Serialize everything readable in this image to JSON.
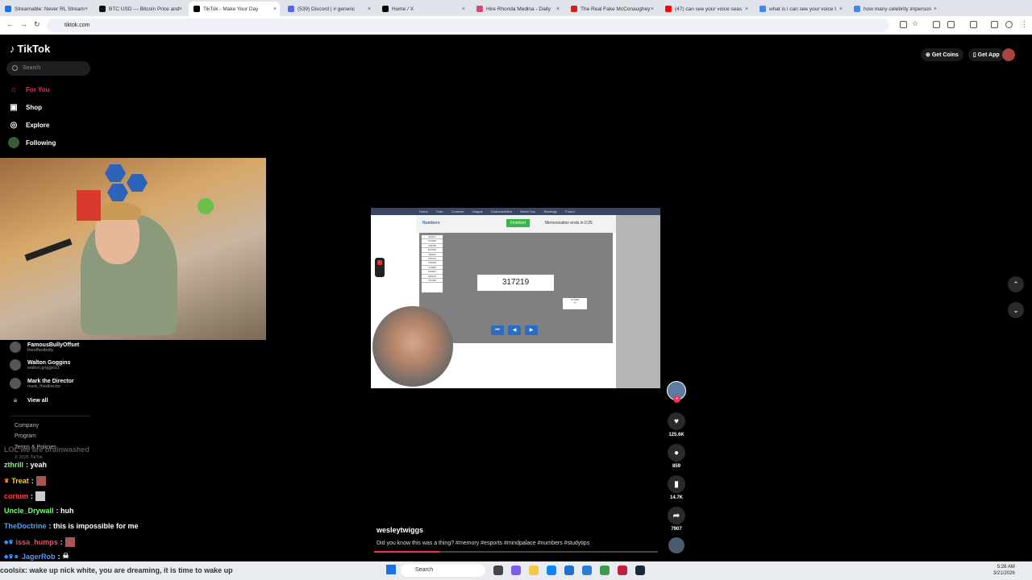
{
  "browser": {
    "tabs": [
      {
        "title": "Streamable: Never RL Stream",
        "color": "#1a73e8"
      },
      {
        "title": "BTC USD — Bitcoin Price and",
        "color": "#111111"
      },
      {
        "title": "TikTok - Make Your Day",
        "color": "#000000"
      },
      {
        "title": "(539) Discord | # generic",
        "color": "#5865f2"
      },
      {
        "title": "Home / X",
        "color": "#000000"
      },
      {
        "title": "Hire Rhonda Medina - Daily",
        "color": "#d14a7a"
      },
      {
        "title": "The Real Fake McConaughey",
        "color": "#cc2222"
      },
      {
        "title": "(47) can see your voice seas",
        "color": "#ff0000"
      },
      {
        "title": "what is i can see your voice t",
        "color": "#4285f4"
      },
      {
        "title": "how many celebrity imperson",
        "color": "#4285f4"
      }
    ],
    "url": "tiktok.com"
  },
  "tiktok": {
    "logo": "TikTok",
    "search_placeholder": "Search",
    "nav": [
      {
        "label": "For You",
        "icon": "home-icon"
      },
      {
        "label": "Shop",
        "icon": "shop-icon"
      },
      {
        "label": "Explore",
        "icon": "compass-icon"
      },
      {
        "label": "Following",
        "icon": "users-icon"
      }
    ],
    "following": [
      {
        "name": "FamousBullyOffset",
        "handle": "theoffsetbully"
      },
      {
        "name": "Walton Goggins",
        "handle": "walton.goggins1"
      },
      {
        "name": "Mark the Director",
        "handle": "mark_thedirector"
      }
    ],
    "view_all": "View all",
    "footer": [
      "Company",
      "Program",
      "Terms & Policies",
      "© 2026 TikTok"
    ],
    "get_coins": "Get Coins",
    "get_app": "Get App",
    "video": {
      "site_nav": [
        "Home",
        "Train",
        "Contests",
        "League",
        "Characteristics",
        "World Tour",
        "Rankings",
        "Forum"
      ],
      "section": "Numbers",
      "button": "Finished",
      "timer": "Memorization ends in 0:25",
      "numbers": [
        "536017",
        "072096",
        "748786",
        "547336",
        "256811",
        "752472",
        "793336",
        "376896",
        "183697",
        "981120",
        "767096"
      ],
      "current_number": "317219",
      "small_box": [
        "071298",
        "??"
      ]
    },
    "actions": {
      "likes": "125.6K",
      "comments": "859",
      "saves": "14.7K",
      "shares": "7907"
    },
    "author": "wesleytwiggs",
    "caption": "Did you know this was a thing? #memory #esports #mindpalace #numbers #studytips",
    "progress": 0.23
  },
  "chat": {
    "ghost": "LOL we are brainwashed",
    "messages": [
      {
        "user": "zthrill",
        "text": ": yeah",
        "color": "#7cfc7c"
      },
      {
        "user": "Treat",
        "text": ":",
        "color": "#ffd700"
      },
      {
        "user": "corium",
        "text": ":",
        "color": "#ff4444"
      },
      {
        "user": "Uncle_Drywall",
        "text": ": huh",
        "color": "#7cfc7c"
      },
      {
        "user": "TheDoctrine",
        "text": ": this is impossible for me",
        "color": "#4aa3ff"
      },
      {
        "user": "issa_humps",
        "text": ":",
        "color": "#ff4466"
      },
      {
        "user": "JagerRob",
        "text": ":",
        "color": "#5599ff"
      }
    ],
    "ticker": "coolsix: wake up nick white, you are dreaming, it is time to wake up"
  },
  "taskbar": {
    "search": "Search",
    "time": "5:28 AM",
    "date": "3/21/2026"
  }
}
